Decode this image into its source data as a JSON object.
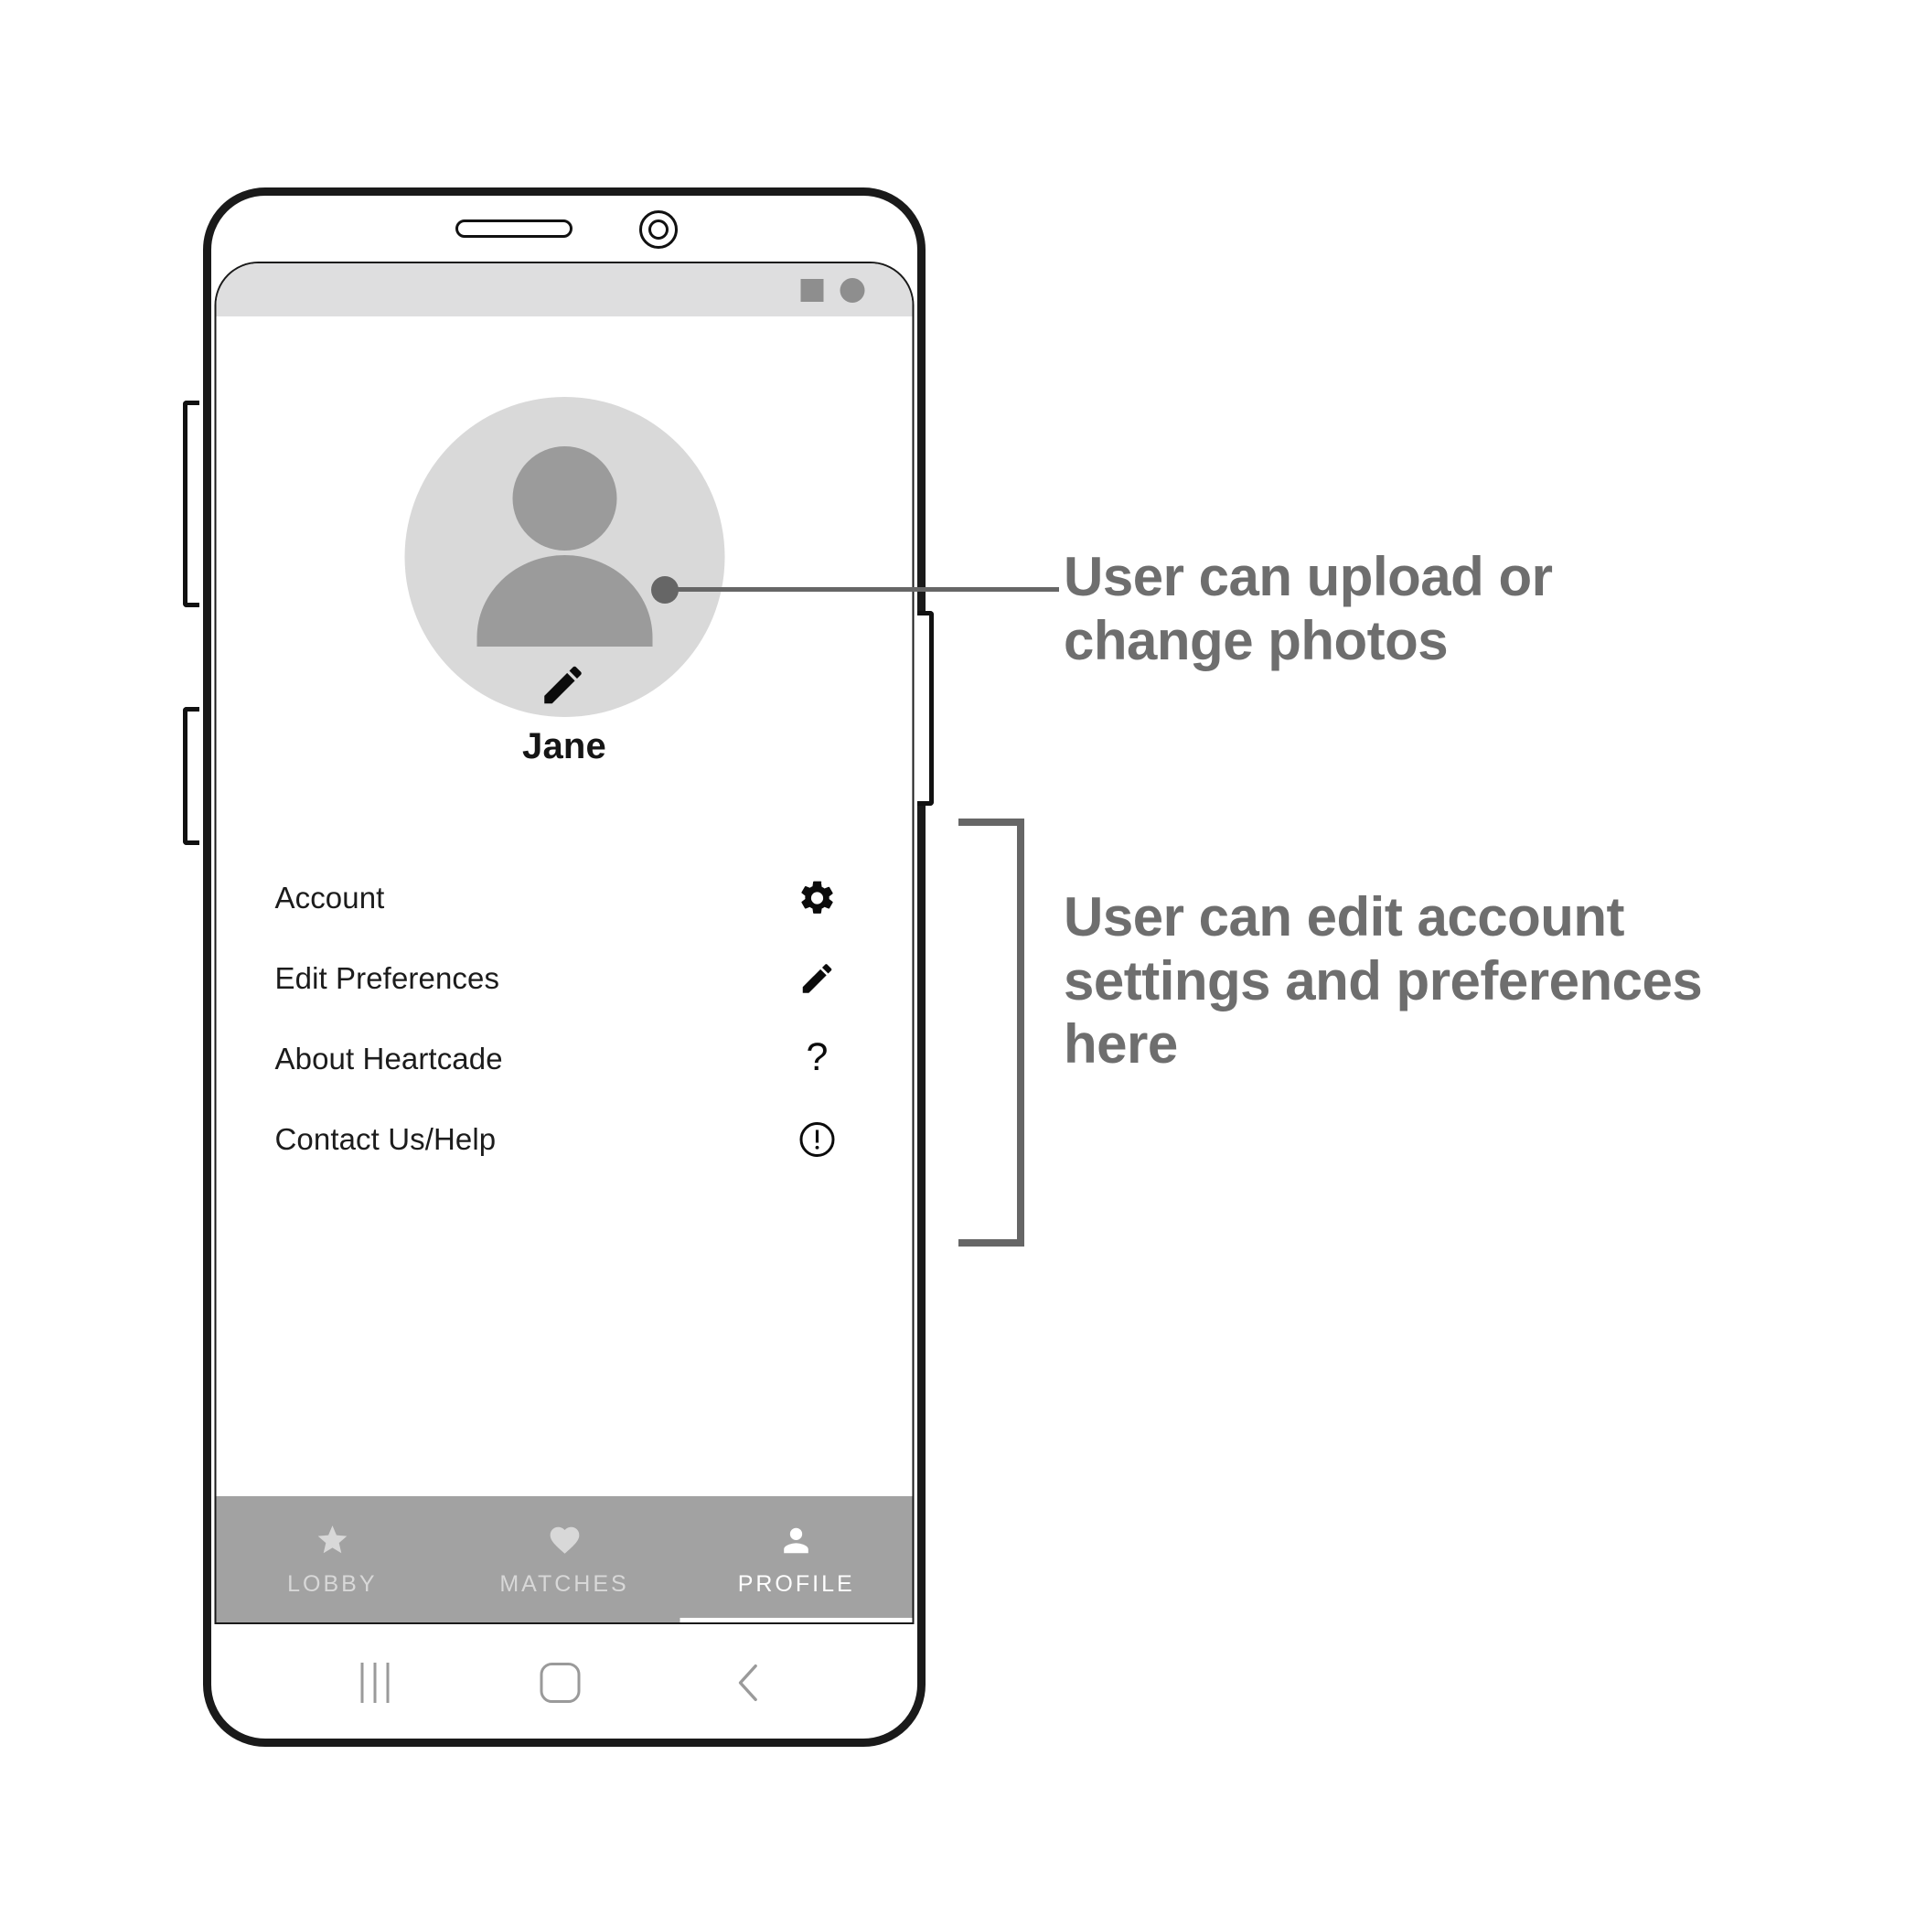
{
  "phone": {
    "status_bar": {
      "icons": [
        "status-square-icon",
        "status-dot-icon"
      ]
    },
    "android_nav": {
      "recent_label": "recent-apps-icon",
      "home_label": "home-icon",
      "back_label": "back-icon"
    }
  },
  "profile": {
    "avatar_icon": "person-avatar-icon",
    "edit_photo_icon": "pencil-icon",
    "name": "Jane"
  },
  "menu": {
    "items": [
      {
        "label": "Account",
        "icon": "gear-icon",
        "glyph": ""
      },
      {
        "label": "Edit Preferences",
        "icon": "pencil-icon",
        "glyph": ""
      },
      {
        "label": "About Heartcade",
        "icon": "question-mark-icon",
        "glyph": "?"
      },
      {
        "label": "Contact Us/Help",
        "icon": "exclamation-circle-icon",
        "glyph": ""
      }
    ]
  },
  "tabs": [
    {
      "label": "LOBBY",
      "icon": "star-icon",
      "active": false
    },
    {
      "label": "MATCHES",
      "icon": "heart-icon",
      "active": false
    },
    {
      "label": "PROFILE",
      "icon": "person-icon",
      "active": true
    }
  ],
  "annotations": {
    "photos": "User can upload or change photos",
    "settings": "User can edit account settings and preferences here"
  },
  "colors": {
    "annotation_text": "#6e6e6e",
    "annotation_line": "#666666",
    "tab_bar": "#a2a2a2",
    "status_bar": "#dededf",
    "avatar_bg": "#d9d9d9",
    "avatar_fg": "#9b9b9b",
    "frame": "#1a1a1a"
  }
}
